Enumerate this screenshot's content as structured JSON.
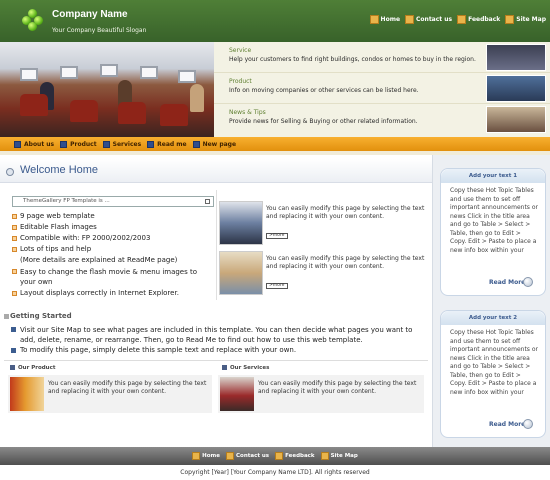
{
  "header": {
    "company": "Company Name",
    "slogan": "Your Company Beautiful Slogan",
    "nav": [
      "Home",
      "Contact us",
      "Feedback",
      "Site Map"
    ]
  },
  "banner": {
    "rows": [
      {
        "title": "Service",
        "text": "Help your customers to find right buildings, condos or homes to buy in the region."
      },
      {
        "title": "Product",
        "text": "Info on moving companies or other services can be listed here."
      },
      {
        "title": "News & Tips",
        "text": "Provide news for Selling & Buying or other related information."
      }
    ]
  },
  "mainnav": [
    "About us",
    "Product",
    "Services",
    "Read me",
    "New page"
  ],
  "welcome": {
    "title": "Welcome Home"
  },
  "select": {
    "value": "ThemeGallery FP Template is ..."
  },
  "features": [
    "9 page web template",
    "Editable Flash images",
    "Compatible with: FP 2000/2002/2003",
    "Lots of tips and help",
    "Easy to change the flash movie & menu images to your own",
    "Layout displays correctly in Internet Explorer."
  ],
  "features_note": "(More details are explained at ReadMe page)",
  "promo": {
    "text": "You can easily modify this page by selecting the text and replacing it with your own content.",
    "more": ">more"
  },
  "getting_started": {
    "title": "Getting Started",
    "p1": "Visit our Site Map to see what pages are included in this template. You can then decide what pages you want to add, delete, rename, or rearrange. Then, go to Read Me to find out how to use this web template.",
    "p2": "To modify this page, simply delete this sample text and replace with your own."
  },
  "sections": {
    "product": "Our Product",
    "services": "Our Services",
    "card_text": "You can easily modify this page by selecting the text and replacing it with your own content."
  },
  "sidebar": {
    "boxes": [
      {
        "title": "Add your text 1",
        "text": "Copy these Hot Topic Tables and use them to set off important announcements or news Click in the title area and go to Table > Select > Table, then go to Edit > Copy. Edit > Paste to place a new info box within your",
        "readmore": "Read More"
      },
      {
        "title": "Add your text 2",
        "text": "Copy these Hot Topic Tables and use them to set off important announcements or news Click in the title area and go to Table > Select > Table, then go to Edit > Copy. Edit > Paste to place a new info box within your",
        "readmore": "Read More"
      }
    ]
  },
  "footer": {
    "nav": [
      "Home",
      "Contact us",
      "Feedback",
      "Site Map"
    ],
    "copyright": "Copyright [Year] [Your Company Name LTD]. All rights reserved"
  },
  "colors": {
    "header_green": "#4f7f37",
    "nav_orange": "#f8b030",
    "accent_blue": "#3b5a8d"
  }
}
